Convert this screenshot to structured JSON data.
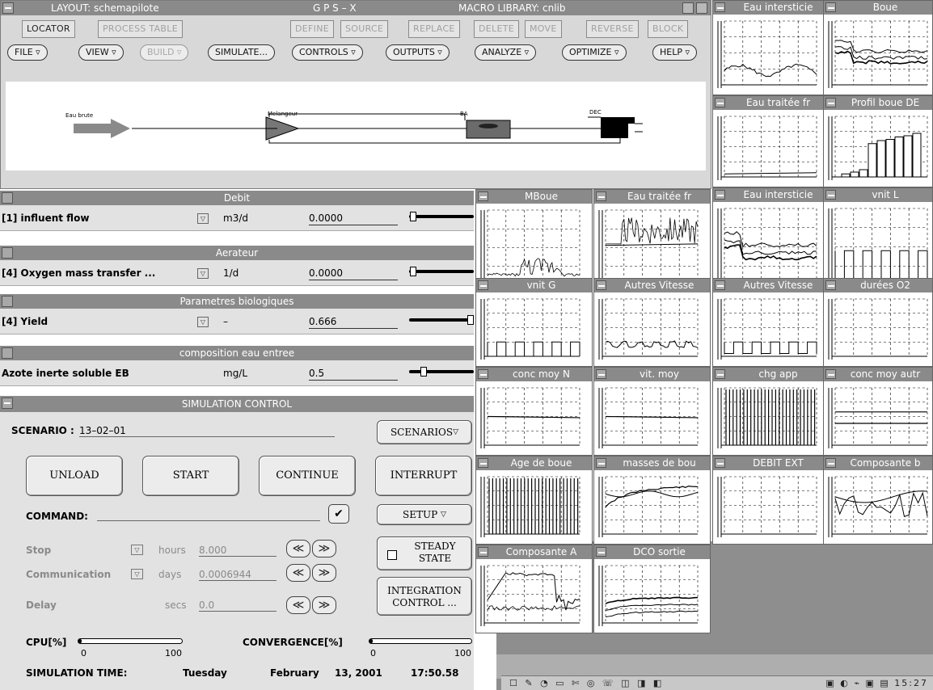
{
  "layout_window": {
    "title_left": "LAYOUT: schemapilote",
    "title_center": "G P S – X",
    "title_right": "MACRO LIBRARY: cnlib",
    "toolbar": {
      "locator": "LOCATOR",
      "process_table": "PROCESS TABLE",
      "define": "DEFINE",
      "source": "SOURCE",
      "replace": "REPLACE",
      "delete": "DELETE",
      "move": "MOVE",
      "reverse": "REVERSE",
      "block": "BLOCK"
    },
    "menus": {
      "file": "FILE ▿",
      "view": "VIEW ▿",
      "build": "BUILD ▿",
      "simulate": "SIMULATE...",
      "controls": "CONTROLS ▿",
      "outputs": "OUTPUTS ▿",
      "analyze": "ANALYZE ▿",
      "optimize": "OPTIMIZE ▿",
      "help": "HELP ▿"
    },
    "nodes": {
      "influent": "Eau brute",
      "mixer": "Melangeur",
      "basin": "BA",
      "clarifier": "DEC"
    }
  },
  "panels": [
    {
      "title": "Debit",
      "label": "[1] influent flow",
      "unit": "m3/d",
      "value": "0.0000",
      "slider_fraction": 0.02
    },
    {
      "title": "Aerateur",
      "label": "[4] Oxygen mass transfer ...",
      "unit": "1/d",
      "value": "0.0000",
      "slider_fraction": 0.02
    },
    {
      "title": "Parametres biologiques",
      "label": "[4] Yield",
      "unit": "–",
      "value": "0.666",
      "slider_fraction": 1.0
    },
    {
      "title": "composition eau entree",
      "label": "Azote inerte soluble EB",
      "unit": "mg/L",
      "value": "0.5",
      "slider_fraction": 0.2
    }
  ],
  "sim": {
    "title": "SIMULATION CONTROL",
    "scenario_label": "SCENARIO :",
    "scenario_value": "13–02–01",
    "scenarios_btn": "SCENARIOS",
    "unload": "UNLOAD",
    "start": "START",
    "continue": "CONTINUE",
    "interrupt": "INTERRUPT",
    "command_label": "COMMAND:",
    "setup": "SETUP",
    "steady_1": "STEADY",
    "steady_2": "STATE",
    "integration_1": "INTEGRATION",
    "integration_2": "CONTROL ...",
    "stop_label": "Stop",
    "stop_unit": "hours",
    "stop_value": "8.000",
    "comm_label": "Communication",
    "comm_unit": "days",
    "comm_value": "0.0006944",
    "delay_label": "Delay",
    "delay_unit": "secs",
    "delay_value": "0.0",
    "rewind": "≪",
    "forward": "≫",
    "cpu_label": "CPU[%]",
    "cpu_min": "0",
    "cpu_max": "100",
    "cpu_fraction": 0.02,
    "conv_label": "CONVERGENCE[%]",
    "conv_min": "0",
    "conv_max": "100",
    "conv_fraction": 0.02,
    "time_label": "SIMULATION TIME:",
    "time_day": "Tuesday",
    "time_month": "February",
    "time_date": "13, 2001",
    "time_clock": "17:50.58"
  },
  "plots": [
    {
      "title": "Eau intersticie",
      "kind": "flatwave"
    },
    {
      "title": "Boue",
      "kind": "multiflat"
    },
    {
      "title": "Eau traitée fr",
      "kind": "lowflat"
    },
    {
      "title": "Profil boue DE",
      "kind": "bars"
    },
    {
      "title": "MBoue",
      "kind": "noise_low"
    },
    {
      "title": "Eau traitée fr",
      "kind": "noise_high"
    },
    {
      "title": "Eau intersticie",
      "kind": "multiflat"
    },
    {
      "title": "vnit L",
      "kind": "squares"
    },
    {
      "title": "vnit G",
      "kind": "squares_low"
    },
    {
      "title": "Autres Vitesse",
      "kind": "steps_low"
    },
    {
      "title": "Autres Vitesse",
      "kind": "squares_small"
    },
    {
      "title": "durées O2",
      "kind": "empty"
    },
    {
      "title": "conc moy N",
      "kind": "midflat"
    },
    {
      "title": "vit. moy",
      "kind": "midflat"
    },
    {
      "title": "chg app",
      "kind": "dense"
    },
    {
      "title": "conc moy autr",
      "kind": "twolines"
    },
    {
      "title": "Age de boue",
      "kind": "dense"
    },
    {
      "title": "masses de bou",
      "kind": "curves"
    },
    {
      "title": "DEBIT EXT",
      "kind": "empty"
    },
    {
      "title": "Composante b",
      "kind": "zigzag"
    },
    {
      "title": "Composante A",
      "kind": "plateau"
    },
    {
      "title": "DCO sortie",
      "kind": "decay"
    }
  ],
  "taskbar": {
    "left": "☐ ✎ ◔ ▭ ✄ ◎ ☏ ◫ ◨ ◧",
    "right": "▣ ◐ ⌁ ▣ ▤  15:27"
  },
  "colors": {
    "titlebar": "#8a8a8a",
    "panel": "#e2e2e2",
    "window": "#d8d8d8",
    "desktop": "#8e8e8e"
  }
}
